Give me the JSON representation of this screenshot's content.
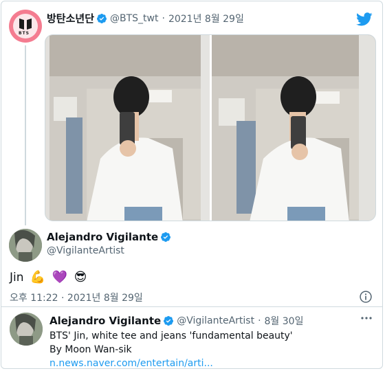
{
  "quoted_tweet": {
    "avatar_text": "BTS",
    "display_name": "방탄소년단",
    "handle": "@BTS_twt",
    "separator": "·",
    "date": "2021년 8월 29일"
  },
  "main_tweet": {
    "display_name": "Alejandro Vigilante",
    "handle": "@VigilanteArtist",
    "text": "Jin",
    "emojis": [
      "💪",
      "💜",
      "😎"
    ],
    "timestamp": "오후 11:22 · 2021년 8월 29일"
  },
  "reply_tweet": {
    "display_name": "Alejandro Vigilante",
    "handle": "@VigilanteArtist",
    "separator": "·",
    "date": "8월 30일",
    "text_line1": "BTS' Jin, white tee and jeans 'fundamental beauty'",
    "text_line2": "By Moon Wan-sik",
    "link": "n.news.naver.com/entertain/arti..."
  },
  "icons": {
    "platform": "twitter-bird-icon",
    "verified": "verified-badge-icon",
    "info": "info-icon",
    "more": "more-options-icon"
  },
  "colors": {
    "brand_blue": "#1d9bf0",
    "muted_text": "#536471",
    "border": "#cfd9de"
  }
}
